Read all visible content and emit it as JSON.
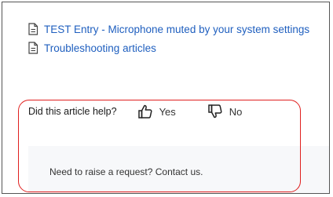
{
  "articles": [
    {
      "label": "TEST Entry - Microphone muted by your system settings",
      "icon": "document-icon"
    },
    {
      "label": "Troubleshooting articles",
      "icon": "document-icon"
    }
  ],
  "feedback": {
    "question": "Did this article help?",
    "yes_label": "Yes",
    "no_label": "No",
    "yes_icon": "thumbs-up-icon",
    "no_icon": "thumbs-down-icon"
  },
  "request": {
    "text": "Need to raise a request? Contact us."
  },
  "colors": {
    "link": "#1f5fbf",
    "highlight": "#e0201f",
    "panel_bg": "#f7f8fa"
  }
}
